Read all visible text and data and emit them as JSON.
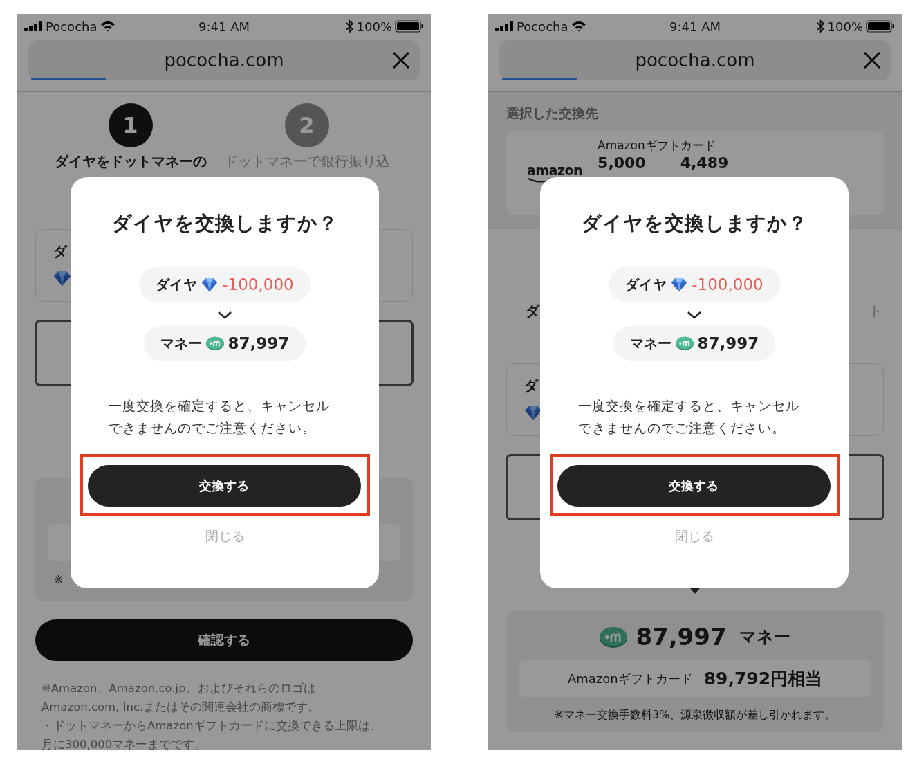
{
  "screens": [
    {
      "status_bar": {
        "carrier": "Pococha",
        "time": "9:41 AM",
        "battery": "100%"
      },
      "address_bar": {
        "url": "pococha.com",
        "level": 0.19
      },
      "background": [
        {
          "kind": "steps",
          "steps": [
            {
              "number": "1",
              "label": "ダイヤをドットマネーの",
              "selected": true
            },
            {
              "number": "2",
              "label": "ドットマネーで銀行振り込",
              "selected": false
            }
          ]
        },
        {
          "kind": "diamond_card",
          "label": "ダ"
        },
        {
          "kind": "outlined_box"
        },
        {
          "kind": "gray_panel",
          "note": "※"
        },
        {
          "kind": "button",
          "label": "確認する"
        },
        {
          "kind": "footnotes",
          "lines": [
            "※Amazon、Amazon.co.jp、およびそれらのロゴはAmazon.com, Inc.またはその関連会社の商標です。",
            "・ドットマネーからAmazonギフトカードに交換できる上限は、月に300,000マネーまでです。"
          ]
        }
      ],
      "dialog": {
        "title": "ダイヤを交換しますか？",
        "from": {
          "label": "ダイヤ",
          "amount": "-100,000"
        },
        "to": {
          "label": "マネー",
          "amount": "87,997"
        },
        "notice": "一度交換を確定すると、キャンセルできませんのでご注意ください。",
        "confirm": "交換する",
        "close": "閉じる",
        "highlighted": true
      }
    },
    {
      "status_bar": {
        "carrier": "Pococha",
        "time": "9:41 AM",
        "battery": "100%"
      },
      "address_bar": {
        "url": "pococha.com",
        "level": 0.19
      },
      "background": [
        {
          "kind": "selected_exchange",
          "title": "選択した交換先",
          "logo": "amazon",
          "name": "Amazonギフトカード",
          "amounts": [
            "5,000",
            "4,489"
          ]
        },
        {
          "kind": "label_fragments",
          "left": "ダ",
          "right": "ト"
        },
        {
          "kind": "diamond_card",
          "label": "ダ"
        },
        {
          "kind": "outlined_box"
        },
        {
          "kind": "pointer"
        },
        {
          "kind": "summary",
          "amount": "87,997",
          "unit": "マネー",
          "gift_name": "Amazonギフトカード",
          "gift_value": "89,792円相当",
          "note": "※マネー交換手数料3%、源泉徴収額が差し引かれます。"
        }
      ],
      "dialog": {
        "title": "ダイヤを交換しますか？",
        "from": {
          "label": "ダイヤ",
          "amount": "-100,000"
        },
        "to": {
          "label": "マネー",
          "amount": "87,997"
        },
        "notice": "一度交換を確定すると、キャンセルできませんのでご注意ください。",
        "confirm": "交換する",
        "close": "閉じる",
        "highlighted": true
      }
    }
  ]
}
